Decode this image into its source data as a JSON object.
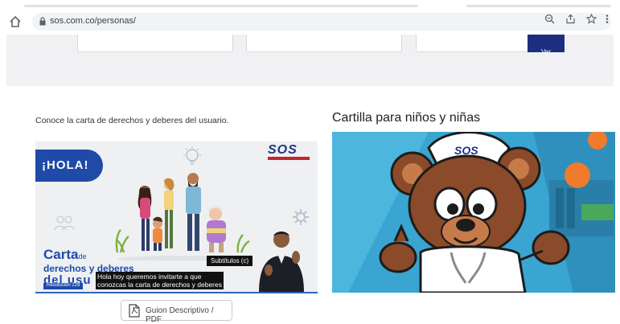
{
  "browser": {
    "url": "sos.com.co/personas/"
  },
  "filter_bar": {
    "ver_label": "Ver"
  },
  "left_section": {
    "title": "Conoce la carta de derechos y deberes del usuario.",
    "video": {
      "greeting": "¡HOLA!",
      "brand": "SOS",
      "heading_carta": "Carta",
      "heading_de": "de",
      "heading_line2": "derechos y deberes",
      "heading_line3": "del usu",
      "resolution": "Resolución 229",
      "subtitles_button": "Subtítulos (c)",
      "caption_line1": "Hola hoy queremos invitarte a que",
      "caption_line2": "conozcas la carta de derechos y deberes"
    },
    "guion_button": "Guion Descriptivo / PDF"
  },
  "right_section": {
    "title": "Cartilla para niños y niñas",
    "bear_hat_text": "SOS"
  },
  "colors": {
    "brand_blue": "#1f4aa8",
    "brand_navy": "#1c2f7f",
    "brand_red": "#c2262e",
    "sky_blue": "#3aa6d1"
  }
}
